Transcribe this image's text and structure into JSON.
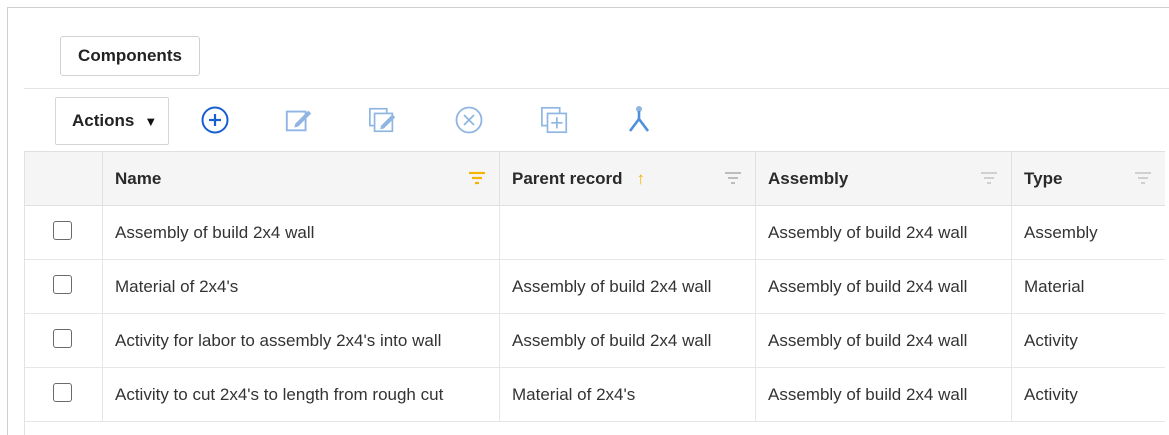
{
  "tabs": {
    "components_label": "Components"
  },
  "toolbar": {
    "actions_label": "Actions",
    "icons": [
      "add-circle-icon",
      "edit-icon",
      "edit-copy-icon",
      "cancel-circle-icon",
      "duplicate-icon",
      "merge-icon"
    ]
  },
  "colors": {
    "accent": "#1a5fd1",
    "icon_muted": "#8fb6e3",
    "sort_accent": "#f5b400",
    "header_bg": "#f5f5f5"
  },
  "table": {
    "columns": [
      "Name",
      "Parent record",
      "Assembly",
      "Type"
    ],
    "sorted_column": "Parent record",
    "sort_direction": "ascending",
    "rows": [
      {
        "name": "Assembly of build 2x4 wall",
        "parent": "",
        "assembly": "Assembly of build 2x4 wall",
        "type": "Assembly"
      },
      {
        "name": "Material of 2x4's",
        "parent": "Assembly of build 2x4 wall",
        "assembly": "Assembly of build 2x4 wall",
        "type": "Material"
      },
      {
        "name": "Activity for labor to assembly 2x4's into wall",
        "parent": "Assembly of build 2x4 wall",
        "assembly": "Assembly of build 2x4 wall",
        "type": "Activity"
      },
      {
        "name": "Activity to cut 2x4's to length from rough cut",
        "parent": "Material of 2x4's",
        "assembly": "Assembly of build 2x4 wall",
        "type": "Activity"
      }
    ]
  }
}
